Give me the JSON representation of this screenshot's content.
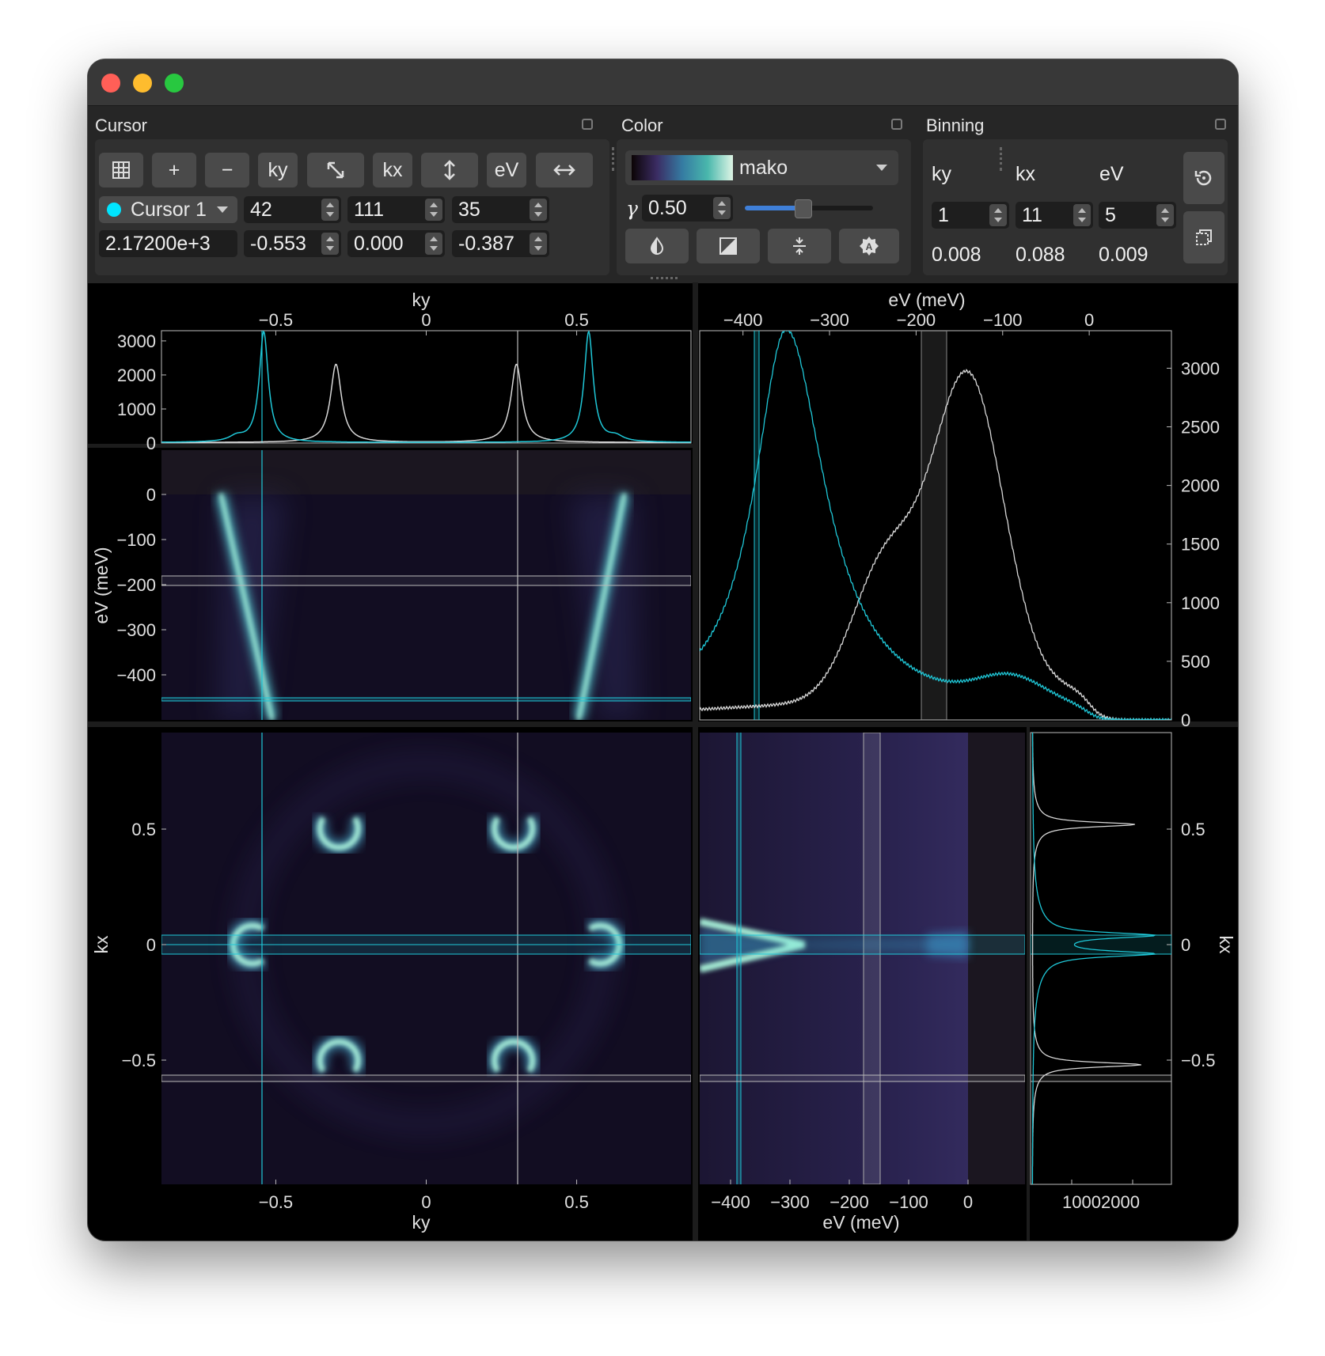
{
  "cursor_panel": {
    "title": "Cursor",
    "buttons": {
      "grid": "grid-icon",
      "add": "+",
      "remove": "−",
      "ky": "ky",
      "diag": "diagonal-arrow-icon",
      "kx": "kx",
      "vert": "vertical-arrow-icon",
      "ev": "eV",
      "horiz": "horizontal-arrow-icon"
    },
    "cursor_select": "Cursor 1",
    "cursor_color": "#00e5ff",
    "indices": {
      "ky": "42",
      "kx": "111",
      "ev": "35"
    },
    "value": "2.17200e+3",
    "coords": {
      "ky": "-0.553",
      "kx": "0.000",
      "ev": "-0.387"
    }
  },
  "color_panel": {
    "title": "Color",
    "colormap": "mako",
    "gamma_symbol": "γ",
    "gamma": "0.50",
    "gamma_fraction": 0.45,
    "buttons": [
      "invert-icon",
      "contrast-icon",
      "center-icon",
      "auto-icon"
    ]
  },
  "binning_panel": {
    "title": "Binning",
    "headers": {
      "ky": "ky",
      "kx": "kx",
      "ev": "eV"
    },
    "bins": {
      "ky": "1",
      "kx": "11",
      "ev": "5"
    },
    "widths": {
      "ky": "0.008",
      "kx": "0.088",
      "ev": "0.009"
    },
    "buttons": [
      "reset-icon",
      "copy-icon"
    ]
  },
  "colors": {
    "cyan": "#1fc8d8",
    "white": "#d8d8d8",
    "background": "#000000"
  },
  "labels": {
    "top_left_xlabel": "ky",
    "top_right_xlabel": "eV (meV)",
    "mid_left_ylabel": "eV (meV)",
    "bottom_left_xlabel": "ky",
    "bottom_left_ylabel": "kx",
    "bottom_mid_xlabel": "eV (meV)",
    "bottom_right_ylabel": "kx"
  },
  "chart_data": [
    {
      "type": "line",
      "id": "ky-profile",
      "xlabel": "ky",
      "xlim": [
        -0.88,
        0.88
      ],
      "xticks": [
        "−0.5",
        "0",
        "0.5"
      ],
      "yticks": [
        "0",
        "1000",
        "2000",
        "3000"
      ],
      "ylim": [
        0,
        3300
      ],
      "series": [
        {
          "color": "#1fc8d8",
          "peaks": [
            {
              "x": -0.54,
              "h": 3250,
              "w": 0.018
            },
            {
              "x": 0.54,
              "h": 3250,
              "w": 0.018
            },
            {
              "x": -0.63,
              "h": 150,
              "w": 0.03
            },
            {
              "x": 0.63,
              "h": 150,
              "w": 0.03
            }
          ]
        },
        {
          "color": "#d8d8d8",
          "peaks": [
            {
              "x": -0.3,
              "h": 2300,
              "w": 0.022
            },
            {
              "x": 0.3,
              "h": 2300,
              "w": 0.022
            }
          ]
        }
      ]
    },
    {
      "type": "line",
      "id": "ev-profile",
      "xlabel": "eV (meV)",
      "xlim": [
        -450,
        95
      ],
      "xticks": [
        "−400",
        "−300",
        "−200",
        "−100",
        "0"
      ],
      "yticks": [
        "0",
        "500",
        "1000",
        "1500",
        "2000",
        "2500",
        "3000"
      ],
      "ylim": [
        0,
        3320
      ],
      "series": [
        {
          "color": "#1fc8d8",
          "shape": "peak near -350 meV, height 3300"
        },
        {
          "color": "#d8d8d8",
          "shape": "peak near -140 meV, height 2850"
        }
      ]
    },
    {
      "type": "heatmap",
      "id": "ky-ev",
      "ylabel": "eV (meV)",
      "yticks": [
        "0",
        "−100",
        "−200",
        "−300",
        "−400"
      ]
    },
    {
      "type": "heatmap",
      "id": "ky-kx",
      "xlabel": "ky",
      "ylabel": "kx",
      "xticks": [
        "−0.5",
        "0",
        "0.5"
      ],
      "yticks": [
        "0.5",
        "0",
        "−0.5"
      ]
    },
    {
      "type": "heatmap",
      "id": "ev-kx",
      "xlabel": "eV (meV)",
      "xticks": [
        "−400",
        "−300",
        "−200",
        "−100",
        "0"
      ]
    },
    {
      "type": "line",
      "id": "kx-profile",
      "ylabel": "kx",
      "xticks": [
        "1000",
        "2000"
      ],
      "yticks": [
        "0.5",
        "0",
        "−0.5"
      ]
    }
  ]
}
